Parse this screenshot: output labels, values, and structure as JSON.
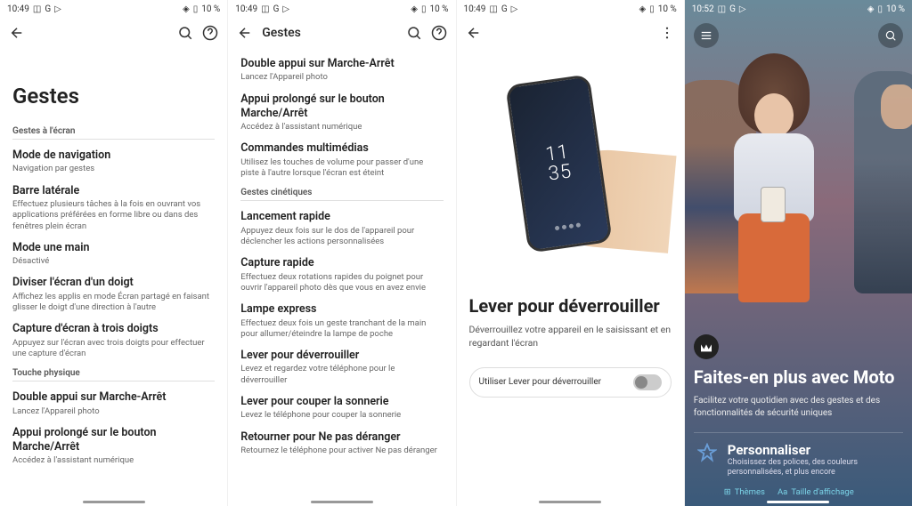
{
  "status": {
    "time1": "10:49",
    "time2": "10:52",
    "battery": "10 %"
  },
  "screen1": {
    "title": "Gestes",
    "section1": "Gestes à l'écran",
    "items1": [
      {
        "title": "Mode de navigation",
        "desc": "Navigation par gestes"
      },
      {
        "title": "Barre latérale",
        "desc": "Effectuez plusieurs tâches à la fois en ouvrant vos applications préférées en forme libre ou dans des fenêtres plein écran"
      },
      {
        "title": "Mode une main",
        "desc": "Désactivé"
      },
      {
        "title": "Diviser l'écran d'un doigt",
        "desc": "Affichez les applis en mode Écran partagé en faisant glisser le doigt d'une direction à l'autre"
      },
      {
        "title": "Capture d'écran à trois doigts",
        "desc": "Appuyez sur l'écran avec trois doigts pour effectuer une capture d'écran"
      }
    ],
    "section2": "Touche physique",
    "items2": [
      {
        "title": "Double appui sur Marche-Arrêt",
        "desc": "Lancez l'Appareil photo"
      },
      {
        "title": "Appui prolongé sur le bouton Marche/Arrêt",
        "desc": "Accédez à l'assistant numérique"
      }
    ]
  },
  "screen2": {
    "header": "Gestes",
    "items1": [
      {
        "title": "Double appui sur Marche-Arrêt",
        "desc": "Lancez l'Appareil photo"
      },
      {
        "title": "Appui prolongé sur le bouton Marche/Arrêt",
        "desc": "Accédez à l'assistant numérique"
      },
      {
        "title": "Commandes multimédias",
        "desc": "Utilisez les touches de volume pour passer d'une piste à l'autre lorsque l'écran est éteint"
      }
    ],
    "section2": "Gestes cinétiques",
    "items2": [
      {
        "title": "Lancement rapide",
        "desc": "Appuyez deux fois sur le dos de l'appareil pour déclencher les actions personnalisées"
      },
      {
        "title": "Capture rapide",
        "desc": "Effectuez deux rotations rapides du poignet pour ouvrir l'appareil photo dès que vous en avez envie"
      },
      {
        "title": "Lampe express",
        "desc": "Effectuez deux fois un geste tranchant de la main pour allumer/éteindre la lampe de poche"
      },
      {
        "title": "Lever pour déverrouiller",
        "desc": "Levez et regardez votre téléphone pour le déverrouiller"
      },
      {
        "title": "Lever pour couper la sonnerie",
        "desc": "Levez le téléphone pour couper la sonnerie"
      },
      {
        "title": "Retourner pour Ne pas déranger",
        "desc": "Retournez le téléphone pour activer Ne pas déranger"
      }
    ]
  },
  "screen3": {
    "phone_time1": "11",
    "phone_time2": "35",
    "title": "Lever pour déverrouiller",
    "desc": "Déverrouillez votre appareil en le saisissant et en regardant l'écran",
    "toggle_label": "Utiliser Lever pour déverrouiller"
  },
  "screen4": {
    "title": "Faites-en plus avec Moto",
    "desc": "Facilitez votre quotidien avec des gestes et des fonctionnalités de sécurité uniques",
    "card_title": "Personnaliser",
    "card_desc": "Choisissez des polices, des couleurs personnalisées, et plus encore",
    "link1": "Thèmes",
    "link2": "Taille d'affichage"
  }
}
